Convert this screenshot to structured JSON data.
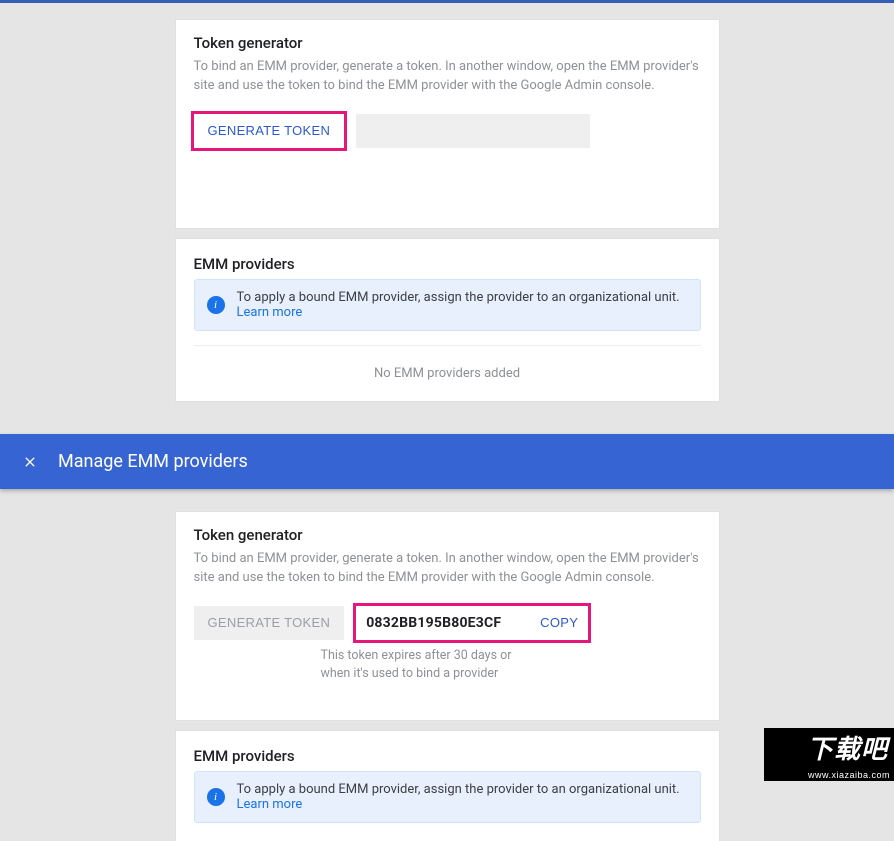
{
  "top": {
    "tokenGen": {
      "heading": "Token generator",
      "desc": "To bind an EMM provider, generate a token. In another window, open the EMM provider's site and use the token to bind the EMM provider with the Google Admin console.",
      "generateBtn": "GENERATE TOKEN"
    },
    "providers": {
      "heading": "EMM providers",
      "infoText": "To apply a bound EMM provider, assign the provider to an organizational unit. ",
      "infoLink": "Learn more",
      "empty": "No EMM providers added"
    }
  },
  "header": {
    "title": "Manage EMM providers"
  },
  "bottom": {
    "tokenGen": {
      "heading": "Token generator",
      "desc": "To bind an EMM provider, generate a token. In another window, open the EMM provider's site and use the token to bind the EMM provider with the Google Admin console.",
      "generateBtn": "GENERATE TOKEN",
      "tokenValue": "0832BB195B80E3CF",
      "copyBtn": "COPY",
      "expireNote": "This token expires after 30 days or when it's used to bind a provider"
    },
    "providers": {
      "heading": "EMM providers",
      "infoText": "To apply a bound EMM provider, assign the provider to an organizational unit. ",
      "infoLink": "Learn more"
    }
  },
  "watermark": {
    "cn": "下载吧",
    "url": "www.xiazaiba.com"
  }
}
